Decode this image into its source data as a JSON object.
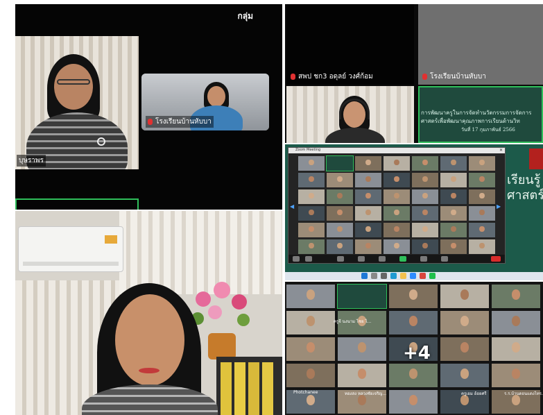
{
  "top_left": {
    "group_label": "กลุ่ม",
    "speaker_main": "บุษราพร",
    "speaker_inset": "โรงเรียนบ้านหับบา"
  },
  "top_right": {
    "tile_left_label": "สพป ชก3 อดุลย์ วงศ์ก้อม",
    "tile_right_label": "โรงเรียนบ้านหับบา",
    "slide_line1": "การพัฒนาครูในการจัดทำนวัตกรรมการจัดการ",
    "slide_line2": "ศาสตร์เพื่อพัฒนาคุณภาพการเรียนด้านวิท",
    "slide_date": "วันที่ 17 กุมภาพันธ์ 2566"
  },
  "screen_share": {
    "window_title": "Zoom Meeting",
    "slide_word1": "เรียนรู้",
    "slide_word2": "ศาสตร์",
    "tile_named_1": "ครูธ นงนาม ไชย โ...",
    "tile_named_2": "Photchanee"
  },
  "bottom_right": {
    "more_count": "+4",
    "tile_labels": [
      "ครูจี นงนาม ไชย ไ...",
      "Photchanee",
      "ทองสง หลวงชัยเจริญ...",
      "ครูเอม อ้อยศรี",
      "ร.ร.บ้านดอนแดงไทร..."
    ]
  },
  "colors": {
    "zoom_black": "#050505",
    "active_speaker_border": "#2fbf5b",
    "slide_green": "#1f4a3d",
    "mic_muted_red": "#e03131"
  }
}
